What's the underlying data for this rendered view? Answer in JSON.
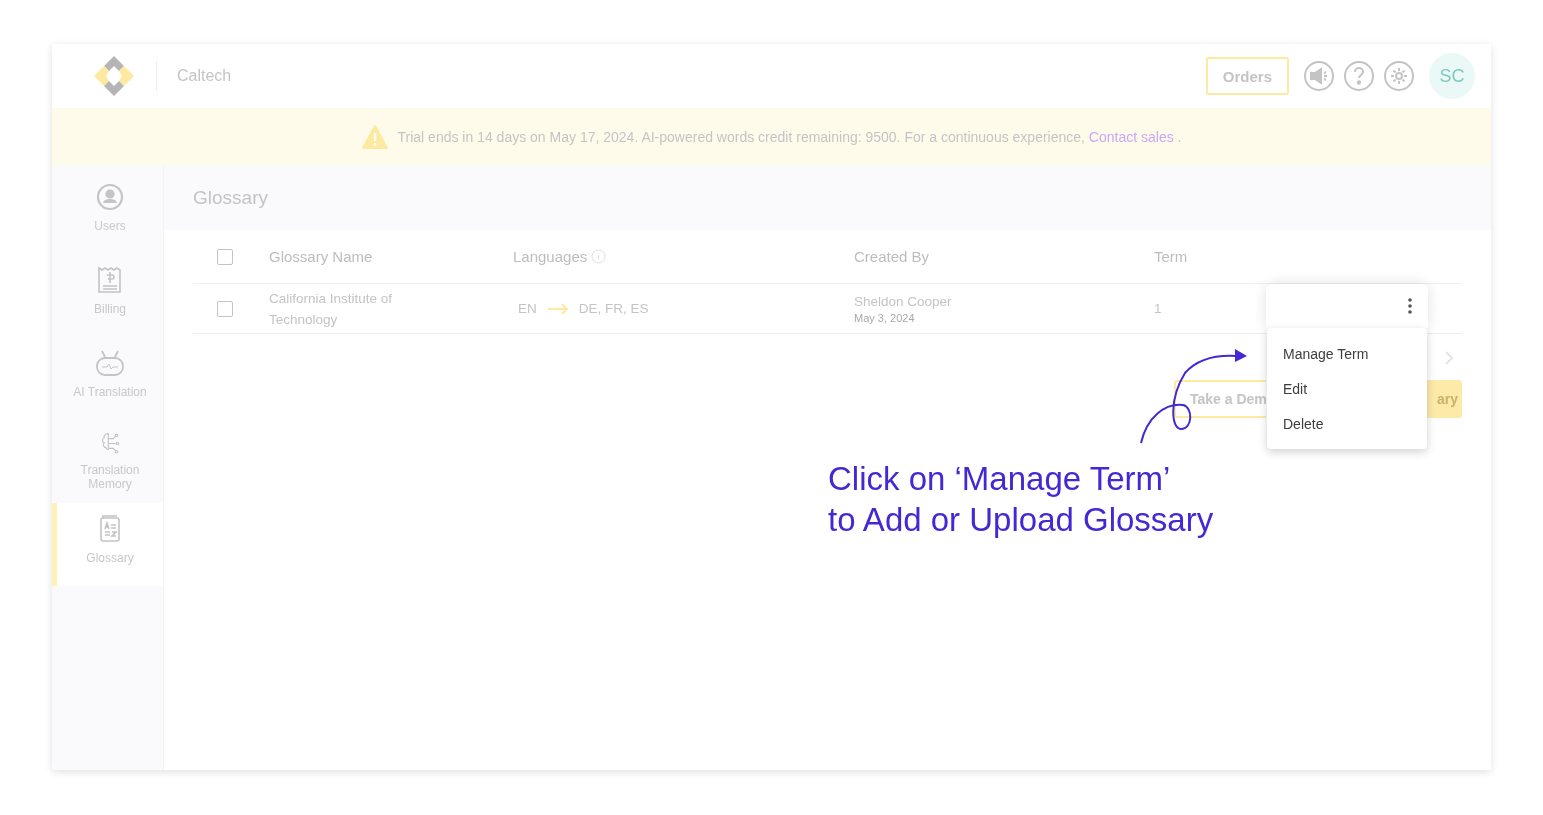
{
  "header": {
    "brand": "Caltech",
    "orders_button": "Orders",
    "avatar": "SC"
  },
  "banner": {
    "text": "Trial ends in 14 days on May 17, 2024. AI-powered words credit remaining: 9500. For a continuous experience,",
    "link": "Contact sales",
    "tail": "."
  },
  "sidebar": {
    "items": [
      {
        "label": "Users",
        "selected": false
      },
      {
        "label": "Billing",
        "selected": false
      },
      {
        "label": "AI Translation",
        "selected": false
      },
      {
        "label": "Translation Memory",
        "selected": false
      },
      {
        "label": "Glossary",
        "selected": true
      }
    ]
  },
  "page_title": "Glossary",
  "table": {
    "select_all": {
      "checked": false
    },
    "columns": [
      "Glossary Name",
      "Languages",
      "Created By",
      "Term"
    ],
    "rows": [
      {
        "checked": false,
        "name": "California Institute of Technology",
        "source": "EN",
        "targets": "DE, FR, ES",
        "created_by": "Sheldon Cooper",
        "created_on": "May 3, 2024",
        "term": "1"
      }
    ]
  },
  "buttons": [
    "Take a Dem",
    "ary"
  ],
  "context_menu": {
    "items": [
      "Manage Term",
      "Edit",
      "Delete"
    ]
  },
  "annotation": {
    "text": "Click on ‘Manage Term’\nto Add or Upload Glossary"
  }
}
